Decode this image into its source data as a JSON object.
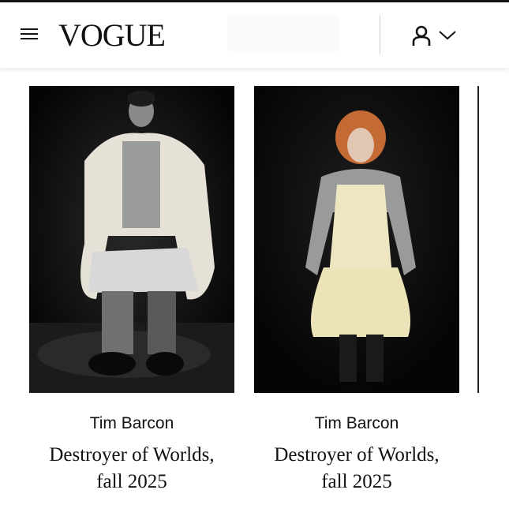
{
  "header": {
    "logo": "VOGUE",
    "menu_icon": "hamburger-menu-icon",
    "account_icon": "person-icon",
    "chevron_icon": "chevron-down-icon"
  },
  "cards": [
    {
      "designer": "Tim Barcon",
      "title_line1": "Destroyer of Worlds,",
      "title_line2": "fall 2025"
    },
    {
      "designer": "Tim Barcon",
      "title_line1": "Destroyer of Worlds,",
      "title_line2": "fall 2025"
    }
  ],
  "colors": {
    "text": "#111111",
    "background": "#ffffff",
    "photo_background": "#0a0a0a"
  }
}
